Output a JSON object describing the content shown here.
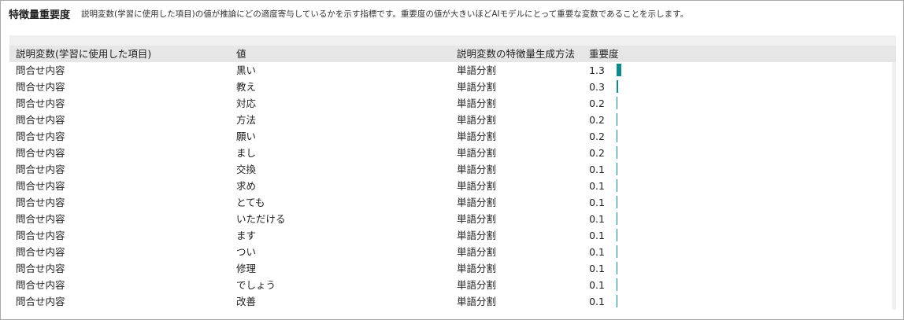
{
  "header": {
    "title": "特徴量重要度",
    "description": "説明変数(学習に使用した項目)の値が推論にどの適度寄与しているかを示す指標です。重要度の値が大きいほどAIモデルにとって重要な変数であることを示します。"
  },
  "table": {
    "columns": {
      "variable": "説明変数(学習に使用した項目)",
      "value": "値",
      "method": "説明変数の特徴量生成方法",
      "importance": "重要度"
    },
    "bar_color": "#0f8a8a",
    "rows": [
      {
        "variable": "問合せ内容",
        "value": "黒い",
        "method": "単語分割",
        "importance": "1.3",
        "score": 1.3
      },
      {
        "variable": "問合せ内容",
        "value": "教え",
        "method": "単語分割",
        "importance": "0.3",
        "score": 0.3
      },
      {
        "variable": "問合せ内容",
        "value": "対応",
        "method": "単語分割",
        "importance": "0.2",
        "score": 0.2
      },
      {
        "variable": "問合せ内容",
        "value": "方法",
        "method": "単語分割",
        "importance": "0.2",
        "score": 0.2
      },
      {
        "variable": "問合せ内容",
        "value": "願い",
        "method": "単語分割",
        "importance": "0.2",
        "score": 0.2
      },
      {
        "variable": "問合せ内容",
        "value": "まし",
        "method": "単語分割",
        "importance": "0.2",
        "score": 0.2
      },
      {
        "variable": "問合せ内容",
        "value": "交換",
        "method": "単語分割",
        "importance": "0.1",
        "score": 0.1
      },
      {
        "variable": "問合せ内容",
        "value": "求め",
        "method": "単語分割",
        "importance": "0.1",
        "score": 0.1
      },
      {
        "variable": "問合せ内容",
        "value": "とても",
        "method": "単語分割",
        "importance": "0.1",
        "score": 0.1
      },
      {
        "variable": "問合せ内容",
        "value": "いただける",
        "method": "単語分割",
        "importance": "0.1",
        "score": 0.1
      },
      {
        "variable": "問合せ内容",
        "value": "ます",
        "method": "単語分割",
        "importance": "0.1",
        "score": 0.1
      },
      {
        "variable": "問合せ内容",
        "value": "つい",
        "method": "単語分割",
        "importance": "0.1",
        "score": 0.1
      },
      {
        "variable": "問合せ内容",
        "value": "修理",
        "method": "単語分割",
        "importance": "0.1",
        "score": 0.1
      },
      {
        "variable": "問合せ内容",
        "value": "でしょう",
        "method": "単語分割",
        "importance": "0.1",
        "score": 0.1
      },
      {
        "variable": "問合せ内容",
        "value": "改善",
        "method": "単語分割",
        "importance": "0.1",
        "score": 0.1
      }
    ]
  }
}
